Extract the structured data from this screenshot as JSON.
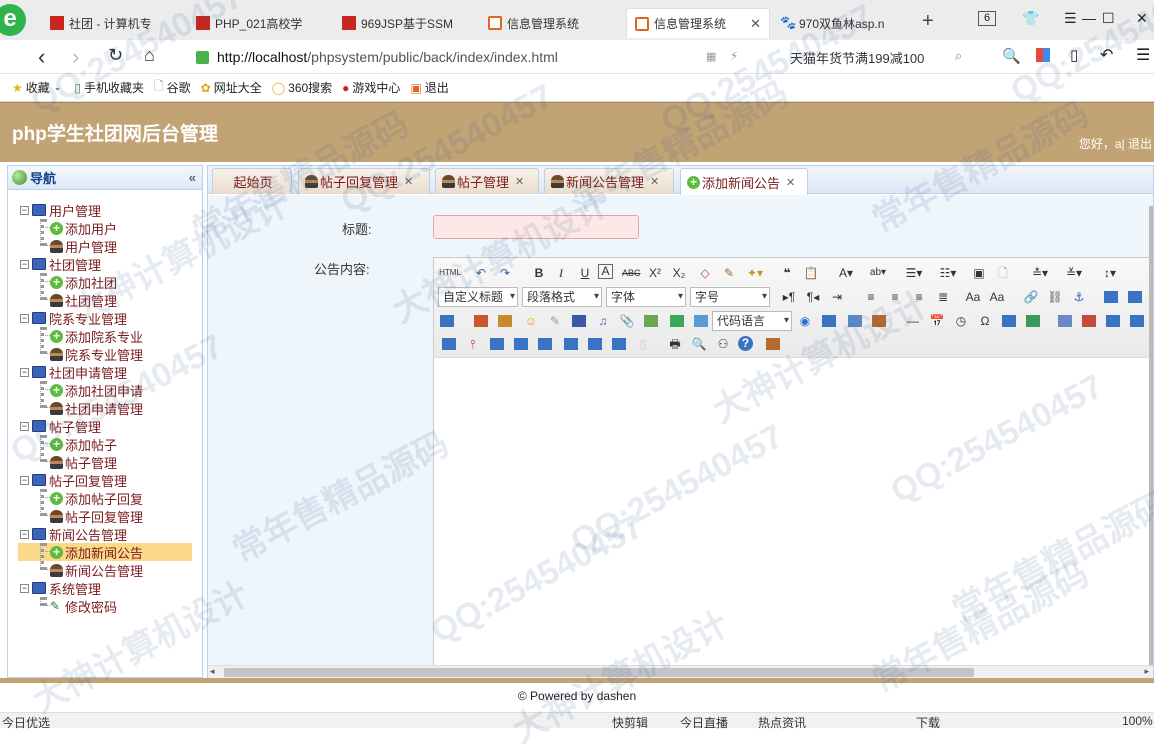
{
  "browser": {
    "tabs": [
      {
        "label": "社团 - 计算机专",
        "icon": "red-square-icon"
      },
      {
        "label": "PHP_021高校学",
        "icon": "red-square-icon"
      },
      {
        "label": "969JSP基于SSM",
        "icon": "red-square-icon"
      },
      {
        "label": "信息管理系统",
        "icon": "orange-page-icon"
      },
      {
        "label": "信息管理系统",
        "icon": "orange-page-icon"
      },
      {
        "label": "970双鱼林asp.n",
        "icon": "paw-icon"
      }
    ],
    "tab_count": "6",
    "url": "http://localhost/phpsystem/public/back/index/index.html",
    "url_host": "http://localhost",
    "url_path": "/phpsystem/public/back/index/index.html",
    "search_promo": "天猫年货节满199减100",
    "bookmarks": [
      "收藏",
      "手机收藏夹",
      "谷歌",
      "网址大全",
      "360搜索",
      "游戏中心",
      "退出"
    ]
  },
  "app": {
    "title": "php学生社团网后台管理",
    "welcome": "您好，a| 退出",
    "accent": "#c2a374"
  },
  "sidebar": {
    "title": "导航",
    "groups": [
      {
        "label": "用户管理",
        "items": [
          "添加用户",
          "用户管理"
        ]
      },
      {
        "label": "社团管理",
        "items": [
          "添加社团",
          "社团管理"
        ]
      },
      {
        "label": "院系专业管理",
        "items": [
          "添加院系专业",
          "院系专业管理"
        ]
      },
      {
        "label": "社团申请管理",
        "items": [
          "添加社团申请",
          "社团申请管理"
        ]
      },
      {
        "label": "帖子管理",
        "items": [
          "添加帖子",
          "帖子管理"
        ]
      },
      {
        "label": "帖子回复管理",
        "items": [
          "添加帖子回复",
          "帖子回复管理"
        ]
      },
      {
        "label": "新闻公告管理",
        "items": [
          "添加新闻公告",
          "新闻公告管理"
        ]
      },
      {
        "label": "系统管理",
        "items": [
          "修改密码"
        ]
      }
    ],
    "selected": "添加新闻公告"
  },
  "tabs": [
    {
      "label": "起始页"
    },
    {
      "label": "帖子回复管理"
    },
    {
      "label": "帖子管理"
    },
    {
      "label": "新闻公告管理"
    },
    {
      "label": "添加新闻公告"
    }
  ],
  "form": {
    "title_label": "标题:",
    "content_label": "公告内容:",
    "toolbar": {
      "custom_title": "自定义标题",
      "paragraph": "段落格式",
      "font": "字体",
      "size": "字号",
      "code_lang": "代码语言",
      "html": "HTML"
    }
  },
  "footer": "© Powered by dashen",
  "status": {
    "left": "今日优选",
    "items": [
      "快剪辑",
      "今日直播",
      "热点资讯",
      "下载",
      "100%"
    ]
  },
  "watermarks": [
    "QQ:254540457",
    "大神计算机设计",
    "常年售精品源码"
  ]
}
